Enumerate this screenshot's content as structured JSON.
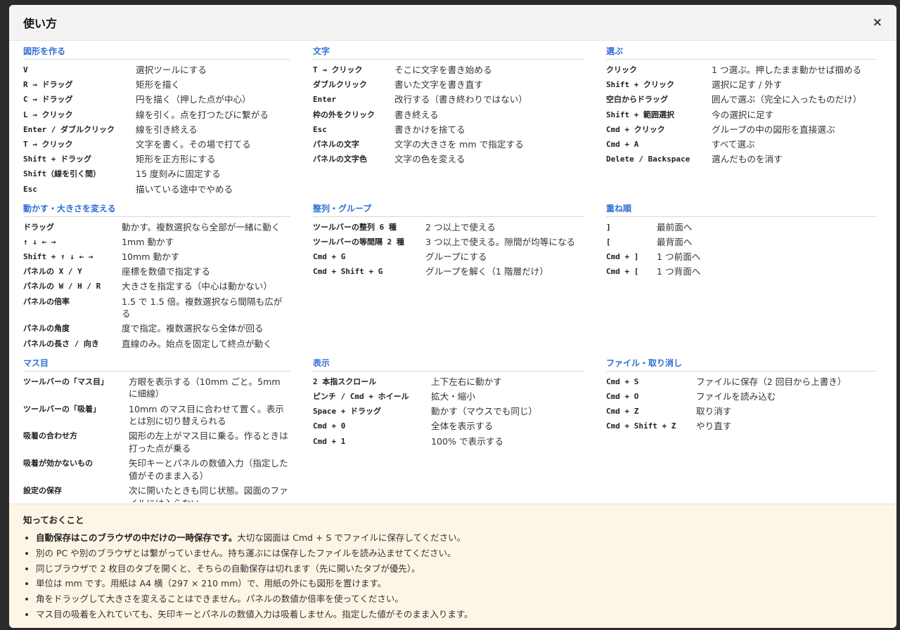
{
  "dialog": {
    "title": "使い方",
    "close_label": "×"
  },
  "sections": [
    {
      "title": "図形を作る",
      "rows": [
        {
          "key": "V",
          "desc": "選択ツールにする"
        },
        {
          "key": "R → ドラッグ",
          "desc": "矩形を描く"
        },
        {
          "key": "C → ドラッグ",
          "desc": "円を描く（押した点が中心）"
        },
        {
          "key": "L → クリック",
          "desc": "線を引く。点を打つたびに繋がる"
        },
        {
          "key": "Enter / ダブルクリック",
          "desc": "線を引き終える"
        },
        {
          "key": "T → クリック",
          "desc": "文字を書く。その場で打てる"
        },
        {
          "key": "Shift + ドラッグ",
          "desc": "矩形を正方形にする"
        },
        {
          "key": "Shift（線を引く間）",
          "desc": "15 度刻みに固定する"
        },
        {
          "key": "Esc",
          "desc": "描いている途中でやめる"
        }
      ]
    },
    {
      "title": "文字",
      "rows": [
        {
          "key": "T → クリック",
          "desc": "そこに文字を書き始める"
        },
        {
          "key": "ダブルクリック",
          "desc": "書いた文字を書き直す"
        },
        {
          "key": "Enter",
          "desc": "改行する（書き終わりではない）"
        },
        {
          "key": "枠の外をクリック",
          "desc": "書き終える"
        },
        {
          "key": "Esc",
          "desc": "書きかけを捨てる"
        },
        {
          "key": "パネルの文字",
          "desc": "文字の大きさを mm で指定する"
        },
        {
          "key": "パネルの文字色",
          "desc": "文字の色を変える"
        }
      ]
    },
    {
      "title": "選ぶ",
      "rows": [
        {
          "key": "クリック",
          "desc": "1 つ選ぶ。押したまま動かせば掴める"
        },
        {
          "key": "Shift + クリック",
          "desc": "選択に足す / 外す"
        },
        {
          "key": "空白からドラッグ",
          "desc": "囲んで選ぶ（完全に入ったものだけ）"
        },
        {
          "key": "Shift + 範囲選択",
          "desc": "今の選択に足す"
        },
        {
          "key": "Cmd + クリック",
          "desc": "グループの中の図形を直接選ぶ"
        },
        {
          "key": "Cmd + A",
          "desc": "すべて選ぶ"
        },
        {
          "key": "Delete / Backspace",
          "desc": "選んだものを消す"
        }
      ]
    },
    {
      "title": "動かす・大きさを変える",
      "rows": [
        {
          "key": "ドラッグ",
          "desc": "動かす。複数選択なら全部が一緒に動く"
        },
        {
          "key": "↑ ↓ ← →",
          "desc": "1mm 動かす"
        },
        {
          "key": "Shift + ↑ ↓ ← →",
          "desc": "10mm 動かす"
        },
        {
          "key": "パネルの X / Y",
          "desc": "座標を数値で指定する"
        },
        {
          "key": "パネルの W / H / R",
          "desc": "大きさを指定する（中心は動かない）"
        },
        {
          "key": "パネルの倍率",
          "desc": "1.5 で 1.5 倍。複数選択なら間隔も広がる"
        },
        {
          "key": "パネルの角度",
          "desc": "度で指定。複数選択なら全体が回る"
        },
        {
          "key": "パネルの長さ / 向き",
          "desc": "直線のみ。始点を固定して終点が動く"
        }
      ]
    },
    {
      "title": "整列・グループ",
      "rows": [
        {
          "key": "ツールバーの整列 6 種",
          "desc": "2 つ以上で使える"
        },
        {
          "key": "ツールバーの等間隔 2 種",
          "desc": "3 つ以上で使える。隙間が均等になる"
        },
        {
          "key": "Cmd + G",
          "desc": "グループにする"
        },
        {
          "key": "Cmd + Shift + G",
          "desc": "グループを解く（1 階層だけ）"
        }
      ]
    },
    {
      "title": "重ね順",
      "rows": [
        {
          "key": "]",
          "desc": "最前面へ"
        },
        {
          "key": "[",
          "desc": "最背面へ"
        },
        {
          "key": "Cmd + ]",
          "desc": "1 つ前面へ"
        },
        {
          "key": "Cmd + [",
          "desc": "1 つ背面へ"
        }
      ]
    },
    {
      "title": "マス目",
      "rows": [
        {
          "key": "ツールバーの「マス目」",
          "desc": "方眼を表示する（10mm ごと。5mm に細線）"
        },
        {
          "key": "ツールバーの「吸着」",
          "desc": "10mm のマス目に合わせて置く。表示とは別に切り替えられる"
        },
        {
          "key": "吸着の合わせ方",
          "desc": "図形の左上がマス目に乗る。作るときは打った点が乗る"
        },
        {
          "key": "吸着が効かないもの",
          "desc": "矢印キーとパネルの数値入力（指定した値がそのまま入る）"
        },
        {
          "key": "設定の保存",
          "desc": "次に開いたときも同じ状態。図面のファイルには入らない"
        }
      ]
    },
    {
      "title": "表示",
      "rows": [
        {
          "key": "2 本指スクロール",
          "desc": "上下左右に動かす"
        },
        {
          "key": "ピンチ / Cmd + ホイール",
          "desc": "拡大・縮小"
        },
        {
          "key": "Space + ドラッグ",
          "desc": "動かす（マウスでも同じ）"
        },
        {
          "key": "Cmd + 0",
          "desc": "全体を表示する"
        },
        {
          "key": "Cmd + 1",
          "desc": "100% で表示する"
        }
      ]
    },
    {
      "title": "ファイル・取り消し",
      "rows": [
        {
          "key": "Cmd + S",
          "desc": "ファイルに保存（2 回目から上書き）"
        },
        {
          "key": "Cmd + O",
          "desc": "ファイルを読み込む"
        },
        {
          "key": "Cmd + Z",
          "desc": "取り消す"
        },
        {
          "key": "Cmd + Shift + Z",
          "desc": "やり直す"
        }
      ]
    }
  ],
  "notes": {
    "title": "知っておくこと",
    "first_bold": "自動保存はこのブラウザの中だけの一時保存です。",
    "first_rest": "大切な図面は Cmd + S でファイルに保存してください。",
    "items": [
      "別の PC や別のブラウザとは繋がっていません。持ち運ぶには保存したファイルを読み込ませてください。",
      "同じブラウザで 2 枚目のタブを開くと、そちらの自動保存は切れます（先に開いたタブが優先）。",
      "単位は mm です。用紙は A4 横（297 × 210 mm）で、用紙の外にも図形を置けます。",
      "角をドラッグして大きさを変えることはできません。パネルの数値か倍率を使ってください。",
      "マス目の吸着を入れていても、矢印キーとパネルの数値入力は吸着しません。指定した値がそのまま入ります。"
    ]
  }
}
